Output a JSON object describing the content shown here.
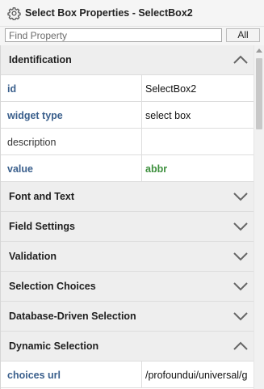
{
  "window": {
    "title": "Select Box Properties - SelectBox2",
    "icon": "gear-icon"
  },
  "search": {
    "placeholder": "Find Property",
    "value": "",
    "all_button_label": "All"
  },
  "sections": {
    "identification": {
      "label": "Identification",
      "expanded": true,
      "properties": [
        {
          "name": "id",
          "value": "SelectBox2",
          "bold": true
        },
        {
          "name": "widget type",
          "value": "select box",
          "bold": true
        },
        {
          "name": "description",
          "value": "",
          "bold": false
        },
        {
          "name": "value",
          "value": "abbr",
          "bold": true,
          "value_color": "#3c8f3c"
        }
      ]
    },
    "font_and_text": {
      "label": "Font and Text",
      "expanded": false
    },
    "field_settings": {
      "label": "Field Settings",
      "expanded": false
    },
    "validation": {
      "label": "Validation",
      "expanded": false
    },
    "selection_choices": {
      "label": "Selection Choices",
      "expanded": false
    },
    "database_driven_selection": {
      "label": "Database-Driven Selection",
      "expanded": false
    },
    "dynamic_selection": {
      "label": "Dynamic Selection",
      "expanded": true,
      "properties": [
        {
          "name": "choices url",
          "value": "/profoundui/universal/g",
          "bold": true
        }
      ]
    }
  },
  "colors": {
    "property_name": "#3a5f8c",
    "value_highlight": "#3c8f3c",
    "section_header_bg": "#eeeeee"
  }
}
